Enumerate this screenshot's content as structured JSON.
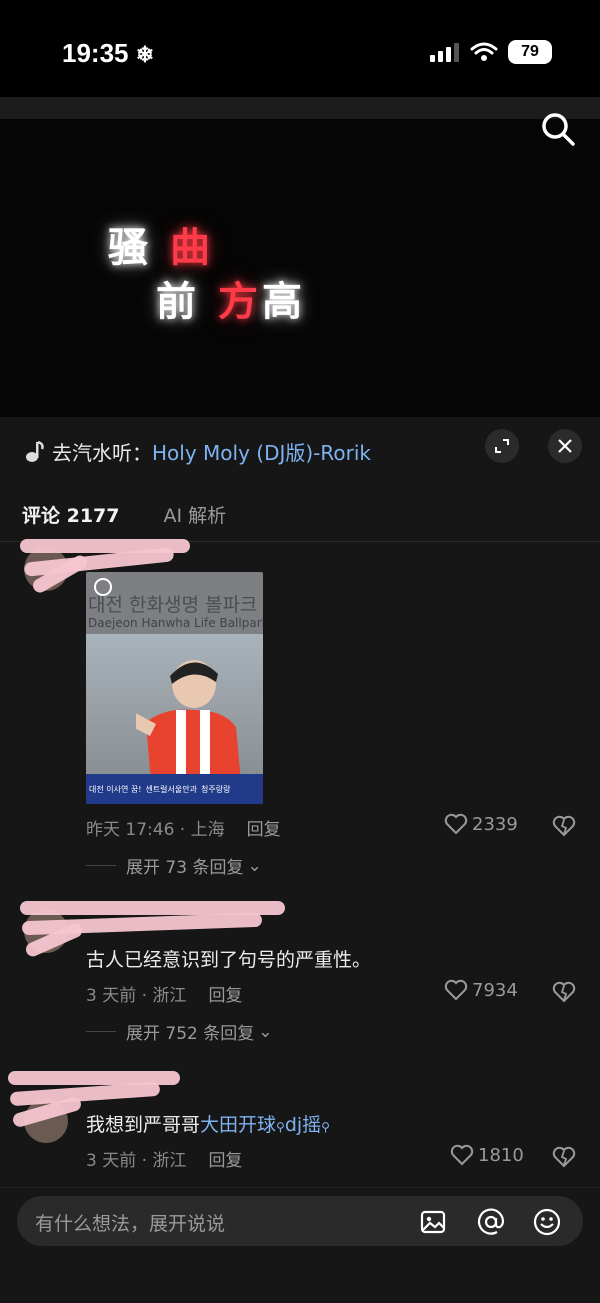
{
  "status_bar": {
    "time": "19:35",
    "battery": "79"
  },
  "video": {
    "lyric_line1": [
      "骚",
      "曲"
    ],
    "lyric_line2": [
      "前",
      "方",
      "高"
    ]
  },
  "panel": {
    "source_prefix": "去汽水听：",
    "song_title": "Holy Moly (DJ版)-Rorik"
  },
  "tabs": [
    {
      "label": "评论 2177"
    },
    {
      "label": "AI 解析"
    }
  ],
  "comments": [
    {
      "image": {
        "sign_ko": "대전 한화생명 볼파크",
        "sign_en": "Daejeon Hanwha Life Ballpark",
        "banner_1": "대전 이사연 꿈!",
        "banner_2": "센트럴서울안과",
        "banner_3": "청주랑랑"
      },
      "time": "昨天 17:46 · 上海",
      "reply": "回复",
      "likes": "2339",
      "expand": "展开 73 条回复"
    },
    {
      "text": "古人已经意识到了句号的严重性。",
      "time": "3 天前 · 浙江",
      "reply": "回复",
      "likes": "7934",
      "expand": "展开 752 条回复"
    },
    {
      "text_prefix": "我想到严哥哥",
      "tag1": "大田开球",
      "tag2": "dj摇",
      "time": "3 天前 · 浙江",
      "reply": "回复",
      "likes": "1810"
    }
  ],
  "input": {
    "placeholder": "有什么想法，展开说说"
  },
  "colors": {
    "accent_blue": "#7fb2f0",
    "lyric_red": "#ff3b4a",
    "background": "#161616"
  }
}
